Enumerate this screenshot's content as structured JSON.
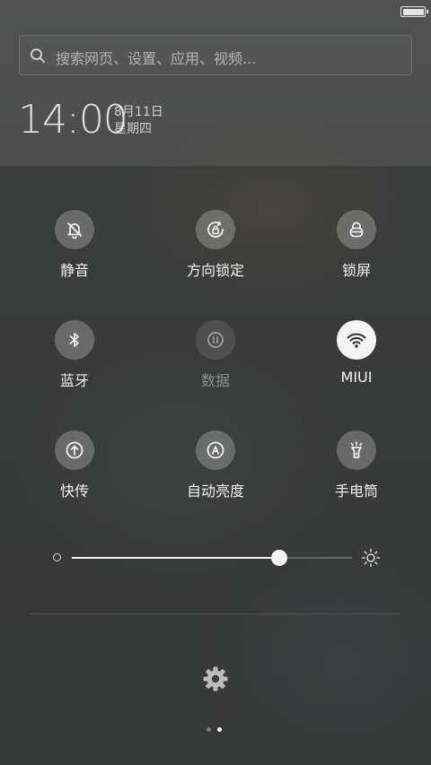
{
  "status_bar": {
    "battery_level": 1.0
  },
  "search": {
    "placeholder": "搜索网页、设置、应用、视频..."
  },
  "clock": {
    "time": "14:00",
    "date": "8月11日",
    "weekday": "星期四"
  },
  "toggles": [
    {
      "label": "静音",
      "icon": "bell-off-icon",
      "state": "off"
    },
    {
      "label": "方向锁定",
      "icon": "rotation-lock-icon",
      "state": "off"
    },
    {
      "label": "锁屏",
      "icon": "lock-icon",
      "state": "off"
    },
    {
      "label": "蓝牙",
      "icon": "bluetooth-icon",
      "state": "off"
    },
    {
      "label": "数据",
      "icon": "mobile-data-icon",
      "state": "disabled"
    },
    {
      "label": "MIUI",
      "icon": "wifi-icon",
      "state": "on"
    },
    {
      "label": "快传",
      "icon": "quick-transfer-icon",
      "state": "off"
    },
    {
      "label": "自动亮度",
      "icon": "auto-brightness-icon",
      "state": "off"
    },
    {
      "label": "手电筒",
      "icon": "flashlight-icon",
      "state": "off"
    }
  ],
  "brightness": {
    "level": 0.74
  },
  "footer": {
    "settings_icon": "gear-icon",
    "page_count": 2,
    "current_page": 2
  },
  "colors": {
    "active_tile": "#f3f3f3",
    "inactive_tile": "rgba(255,255,255,0.24)",
    "text": "#f2f2f2",
    "disabled_text": "rgba(255,255,255,0.42)"
  }
}
